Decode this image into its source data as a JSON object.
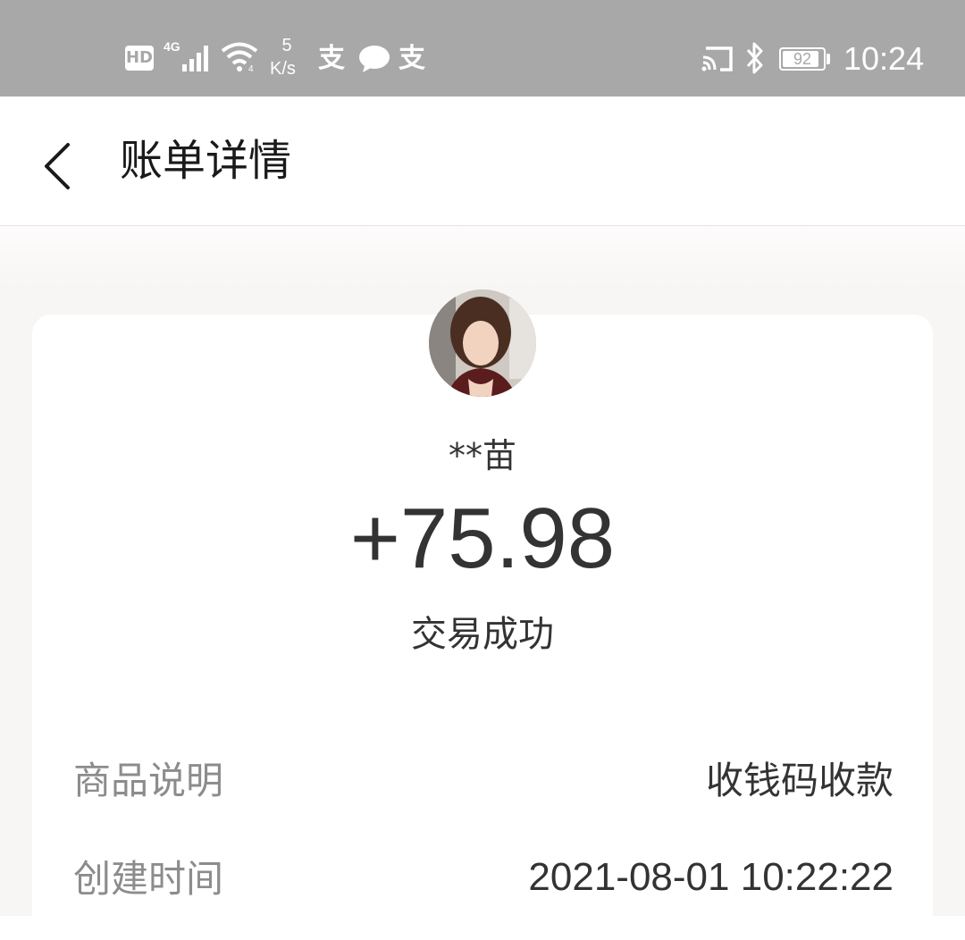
{
  "status_bar": {
    "hd_badge": "HD",
    "network_type": "4G",
    "speed_value": "5",
    "speed_unit": "K/s",
    "alipay_glyph": "支",
    "battery_level": "92",
    "battery_fraction": 0.92,
    "time": "10:24",
    "icons": [
      "hd-icon",
      "signal-icon",
      "wifi-icon",
      "alipay-icon",
      "wechat-icon",
      "alipay-icon",
      "cast-icon",
      "bluetooth-icon",
      "battery-icon"
    ]
  },
  "header": {
    "title": "账单详情",
    "back_icon": "chevron-left-icon"
  },
  "transaction": {
    "avatar": "avatar-photo",
    "payer_name": "**苗",
    "amount": "+75.98",
    "status": "交易成功"
  },
  "details": [
    {
      "label": "商品说明",
      "value": "收钱码收款"
    },
    {
      "label": "创建时间",
      "value": "2021-08-01 10:22:22"
    }
  ],
  "colors": {
    "status_bar_bg": "#a8a8a8",
    "label_gray": "#8c8c8c",
    "text_dark": "#333333",
    "page_bg": "#f8f5f5"
  }
}
